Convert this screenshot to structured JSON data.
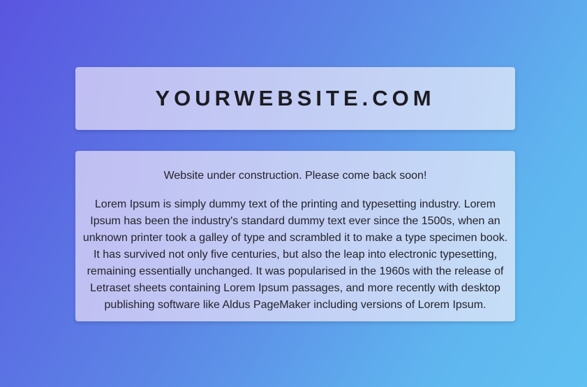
{
  "header": {
    "site_title": "YOURWEBSITE.COM"
  },
  "content": {
    "notice": "Website under construction. Please come back soon!",
    "body": "Lorem Ipsum is simply dummy text of the printing and typesetting industry. Lorem Ipsum has been the industry's standard dummy text ever since the 1500s, when an unknown printer took a galley of type and scrambled it to make a type specimen book. It has survived not only five centuries, but also the leap into electronic typesetting, remaining essentially unchanged. It was popularised in the 1960s with the release of Letraset sheets containing Lorem Ipsum passages, and more recently with desktop publishing software like Aldus PageMaker including versions of Lorem Ipsum."
  },
  "colors": {
    "background_start": "#5a55e0",
    "background_end": "#60c0f2",
    "text": "#23232b"
  }
}
